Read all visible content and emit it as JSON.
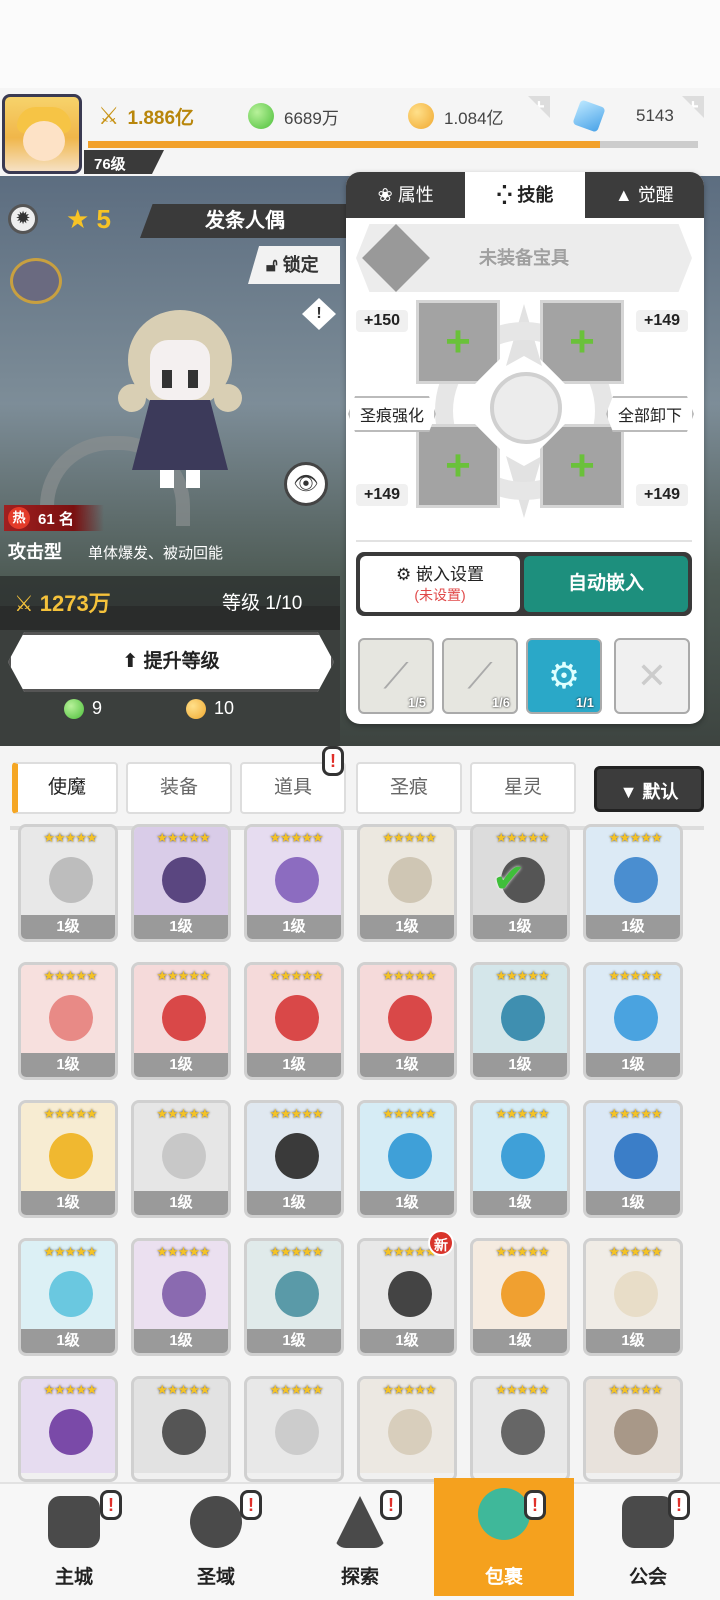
{
  "header": {
    "player_level": "76级",
    "power": "1.886亿",
    "green_currency": "6689万",
    "gold_currency": "1.084亿",
    "gem_currency": "5143",
    "exp_progress": 0.84
  },
  "hero": {
    "stars": "5",
    "name": "发条人偶",
    "lock_label": "锁定",
    "rank_label": "热",
    "rank": "61 名",
    "type": "攻击型",
    "description": "单体爆发、被动回能",
    "power": "1273万",
    "level": "等级 1/10",
    "upgrade_label": "提升等级",
    "cost_green": "9",
    "cost_gold": "10"
  },
  "panel": {
    "tabs": [
      "属性",
      "技能",
      "觉醒"
    ],
    "active_tab": 1,
    "treasure_label": "未装备宝具",
    "bonuses": [
      "+150",
      "+149",
      "+149",
      "+149"
    ],
    "strengthen_label": "圣痕强化",
    "unequip_all_label": "全部卸下",
    "embed_setting_label": "嵌入设置",
    "embed_setting_status": "(未设置)",
    "auto_embed_label": "自动嵌入",
    "skill_counts": [
      "1/5",
      "1/6",
      "1/1"
    ]
  },
  "collection": {
    "tabs": [
      "使魔",
      "装备",
      "道具",
      "圣痕",
      "星灵"
    ],
    "sort_label": "▼ 默认",
    "card_stars": "★★★★★",
    "card_level": "1级",
    "new_badge": "新"
  },
  "nav": {
    "items": [
      "主城",
      "圣域",
      "探索",
      "包裹",
      "公会"
    ],
    "active": 3
  },
  "colors": {
    "accent_orange": "#f5a11e",
    "auto_embed_green": "#1d8f7d",
    "plus_green": "#6ac13a"
  }
}
